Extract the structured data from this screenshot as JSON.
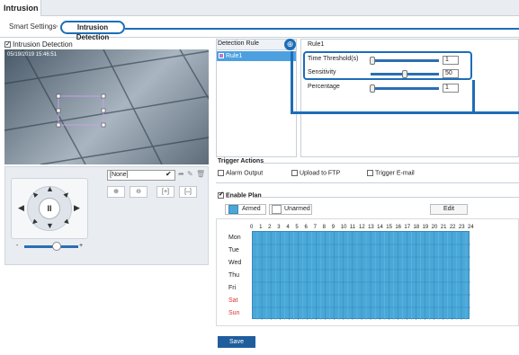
{
  "app": {
    "title": "Intrusion"
  },
  "tabs": {
    "smart_settings": "Smart Settings",
    "separator": ">",
    "intrusion_detection": "Intrusion Detection"
  },
  "video": {
    "enable_label": "Intrusion Detection",
    "timestamp": "05/19/2019 15:46:51"
  },
  "ptz": {
    "center_label": "II",
    "preset_value": "[None]"
  },
  "rules": {
    "header": "Detection Rule",
    "items": [
      {
        "label": "Rule1"
      }
    ]
  },
  "params": {
    "rule_title": "Rule1",
    "time_threshold": {
      "label": "Time Threshold(s)",
      "value": "1",
      "level": 0.02
    },
    "sensitivity": {
      "label": "Sensitivity",
      "value": "50",
      "level": 0.5
    },
    "percentage": {
      "label": "Percentage",
      "value": "1",
      "level": 0.02
    }
  },
  "trigger": {
    "title": "Trigger Actions",
    "alarm_output": "Alarm Output",
    "upload_ftp": "Upload to FTP",
    "trigger_email": "Trigger E-mail"
  },
  "plan": {
    "title": "Enable Plan",
    "armed": "Armed",
    "unarmed": "Unarmed",
    "edit": "Edit",
    "hours": [
      "0",
      "1",
      "2",
      "3",
      "4",
      "5",
      "6",
      "7",
      "8",
      "9",
      "10",
      "11",
      "12",
      "13",
      "14",
      "15",
      "16",
      "17",
      "18",
      "19",
      "20",
      "21",
      "22",
      "23",
      "24"
    ],
    "days": [
      "Mon",
      "Tue",
      "Wed",
      "Thu",
      "Fri",
      "Sat",
      "Sun"
    ]
  },
  "save_label": "Save",
  "colors": {
    "accent": "#1d6db8",
    "armed": "#4aa8d8",
    "weekend": "#e03030"
  }
}
